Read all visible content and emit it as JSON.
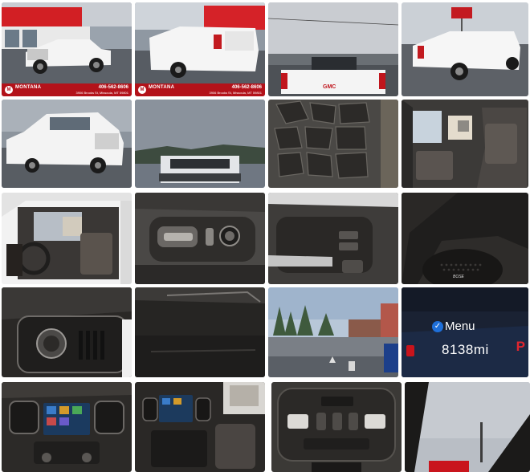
{
  "gallery": {
    "dealer": {
      "brand": "MONTANA",
      "brand_sub": "AUTO",
      "phone": "406-562-8606",
      "address": "3906 Brooks St, Missoula, MT 59801",
      "brand_color": "#b3121a"
    },
    "tiles": [
      {
        "name": "photo-front-quarter-lot",
        "icon": "truck-photo"
      },
      {
        "name": "photo-rear-quarter-lot",
        "icon": "truck-photo"
      },
      {
        "name": "photo-rear-gmc",
        "icon": "truck-photo",
        "tailgate_text": "GMC"
      },
      {
        "name": "photo-rear-quarter-sign",
        "icon": "truck-photo"
      },
      {
        "name": "photo-side-quarter",
        "icon": "truck-photo"
      },
      {
        "name": "photo-front-grille",
        "icon": "truck-photo"
      },
      {
        "name": "photo-tire-tread",
        "icon": "tire-photo"
      },
      {
        "name": "photo-rear-seats",
        "icon": "interior-photo"
      },
      {
        "name": "photo-driver-door-open",
        "icon": "interior-photo"
      },
      {
        "name": "photo-seat-controls",
        "icon": "interior-photo"
      },
      {
        "name": "photo-door-handle",
        "icon": "interior-photo"
      },
      {
        "name": "photo-bose-speaker",
        "icon": "interior-photo",
        "speaker_label": "BOSE"
      },
      {
        "name": "photo-drive-mode-knob",
        "icon": "interior-photo"
      },
      {
        "name": "photo-dash-panel",
        "icon": "interior-photo"
      },
      {
        "name": "photo-lot-view-hud",
        "icon": "scene-photo"
      },
      {
        "name": "photo-odometer",
        "icon": "cluster-photo",
        "menu_label": "Menu",
        "mileage": "8138mi",
        "gear": "P"
      },
      {
        "name": "photo-infotainment",
        "icon": "interior-photo"
      },
      {
        "name": "photo-center-console",
        "icon": "interior-photo"
      },
      {
        "name": "photo-overhead-console",
        "icon": "interior-photo"
      },
      {
        "name": "photo-sunroof-sky",
        "icon": "scene-photo"
      }
    ]
  }
}
